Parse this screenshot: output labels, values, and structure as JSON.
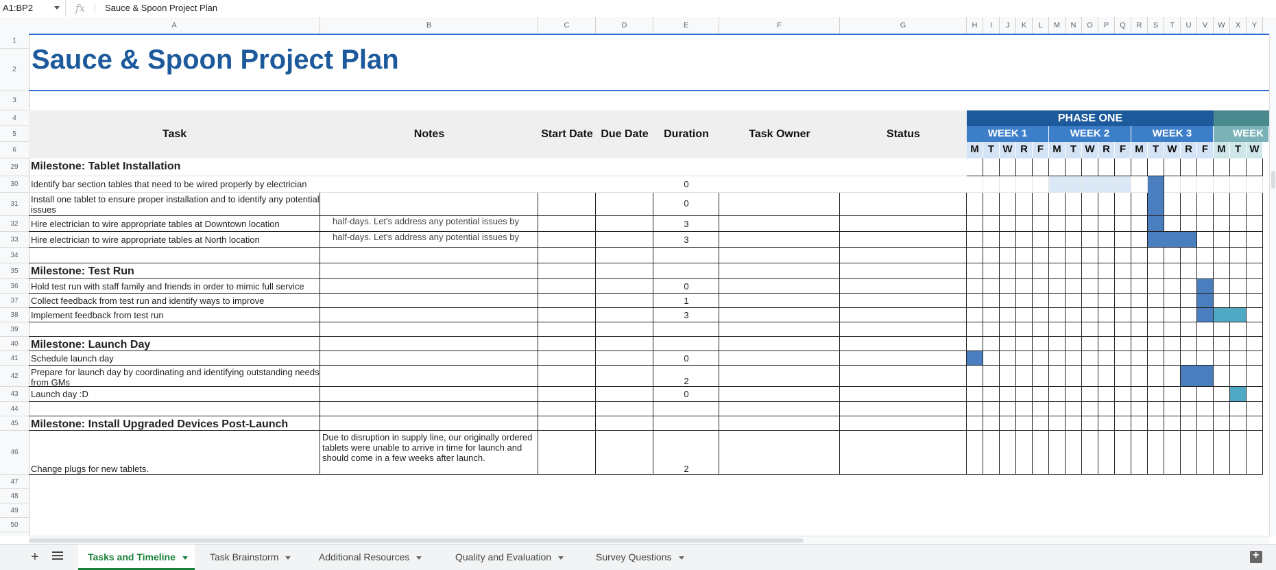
{
  "formula_bar": {
    "name_box": "A1:BP2",
    "fx_symbol": "fx",
    "value": "Sauce & Spoon Project Plan"
  },
  "columns": {
    "left": [
      "A",
      "B",
      "C",
      "D",
      "E",
      "F",
      "G"
    ],
    "right": [
      "H",
      "I",
      "J",
      "K",
      "L",
      "M",
      "N",
      "O",
      "P",
      "Q",
      "R",
      "S",
      "T",
      "U",
      "V",
      "W",
      "X",
      "Y"
    ]
  },
  "rows": [
    "1",
    "2",
    "3",
    "4",
    "5",
    "6",
    "29",
    "30",
    "31",
    "32",
    "33",
    "34",
    "35",
    "36",
    "37",
    "38",
    "39",
    "40",
    "41",
    "42",
    "43",
    "44",
    "45",
    "46",
    "47",
    "48",
    "49",
    "50"
  ],
  "sheet_title": "Sauce & Spoon Project Plan",
  "headers": {
    "task": "Task",
    "notes": "Notes",
    "start_date": "Start Date",
    "due_date": "Due Date",
    "duration": "Duration",
    "task_owner": "Task Owner",
    "status": "Status"
  },
  "timeline": {
    "phase_one": "PHASE ONE",
    "weeks": [
      "WEEK 1",
      "WEEK 2",
      "WEEK 3",
      "WEEK"
    ],
    "days": [
      "M",
      "T",
      "W",
      "R",
      "F",
      "M",
      "T",
      "W",
      "R",
      "F",
      "M",
      "T",
      "W",
      "R",
      "F",
      "M",
      "T",
      "W"
    ]
  },
  "task_rows": {
    "r29": {
      "task": "Milestone: Tablet Installation"
    },
    "r30": {
      "task": "Identify bar section tables that need to be wired properly by electrician",
      "duration": "0"
    },
    "r31": {
      "task": "Install one tablet to ensure proper installation and to identify any potential issues",
      "duration": "0"
    },
    "r32": {
      "task": "Hire electrician to wire appropriate tables at Downtown location",
      "notes": "half-days. Let's address any potential issues by",
      "duration": "3"
    },
    "r33": {
      "task": "Hire electrician to wire appropriate tables at North location",
      "notes": "half-days. Let's address any potential issues by",
      "duration": "3"
    },
    "r35": {
      "task": "Milestone: Test Run"
    },
    "r36": {
      "task": "Hold test run with staff family and friends in order to mimic full service",
      "duration": "0"
    },
    "r37": {
      "task": "Collect feedback from test run and identify ways to improve",
      "duration": "1"
    },
    "r38": {
      "task": "Implement feedback from test run",
      "duration": "3"
    },
    "r40": {
      "task": "Milestone: Launch Day"
    },
    "r41": {
      "task": "Schedule launch day",
      "duration": "0"
    },
    "r42": {
      "task": "Prepare for launch day by coordinating and identifying outstanding needs from GMs",
      "duration": "2"
    },
    "r43": {
      "task": "Launch day :D",
      "duration": "0"
    },
    "r45": {
      "task": "Milestone: Install Upgraded Devices Post-Launch"
    },
    "r46": {
      "task": "Change plugs for new tablets.",
      "notes": "Due to disruption in supply line, our originally ordered tablets were unable to arrive in time for launch and should come in a few weeks after launch.",
      "duration": "2"
    }
  },
  "sheet_tabs": [
    "Tasks and Timeline",
    "Task Brainstorm",
    "Additional Resources",
    "Quality and Evaluation",
    "Survey Questions"
  ],
  "colors": {
    "title": "#1d5a9c",
    "phase": "#1d5a9c",
    "week": "#3d7ec9",
    "bar_blue": "#4a7ebf",
    "bar_teal": "#4fa9c4",
    "active_tab": "#188038"
  }
}
